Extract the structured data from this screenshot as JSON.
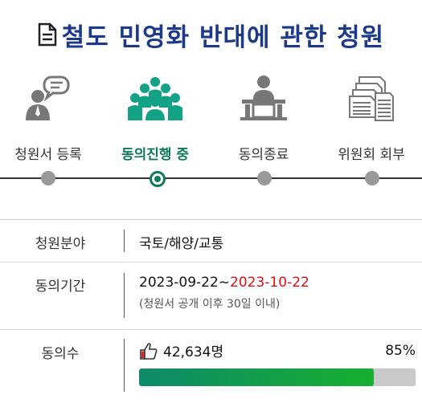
{
  "page": {
    "title": "철도 민영화 반대에 관한 청원"
  },
  "steps": [
    {
      "label": "청원서 등록",
      "icon": "speech-bubble-person-icon",
      "active": false
    },
    {
      "label": "동의진행 중",
      "icon": "group-people-icon",
      "active": true
    },
    {
      "label": "동의종료",
      "icon": "podium-person-icon",
      "active": false
    },
    {
      "label": "위원회 회부",
      "icon": "document-stack-icon",
      "active": false
    }
  ],
  "info": {
    "field_label": "청원분야",
    "field_value": "국토/해양/교통",
    "period_label": "동의기간",
    "period_start": "2023-09-22~",
    "period_end": "2023-10-22",
    "period_note": "(청원서 공개 이후 30일 이내)",
    "count_label": "동의수",
    "count_value": "42,634명",
    "percent_text": "85%",
    "progress": 0.85
  },
  "colors": {
    "title": "#1d3a8a",
    "active": "#0f7a5a",
    "end_date": "#e01010"
  }
}
